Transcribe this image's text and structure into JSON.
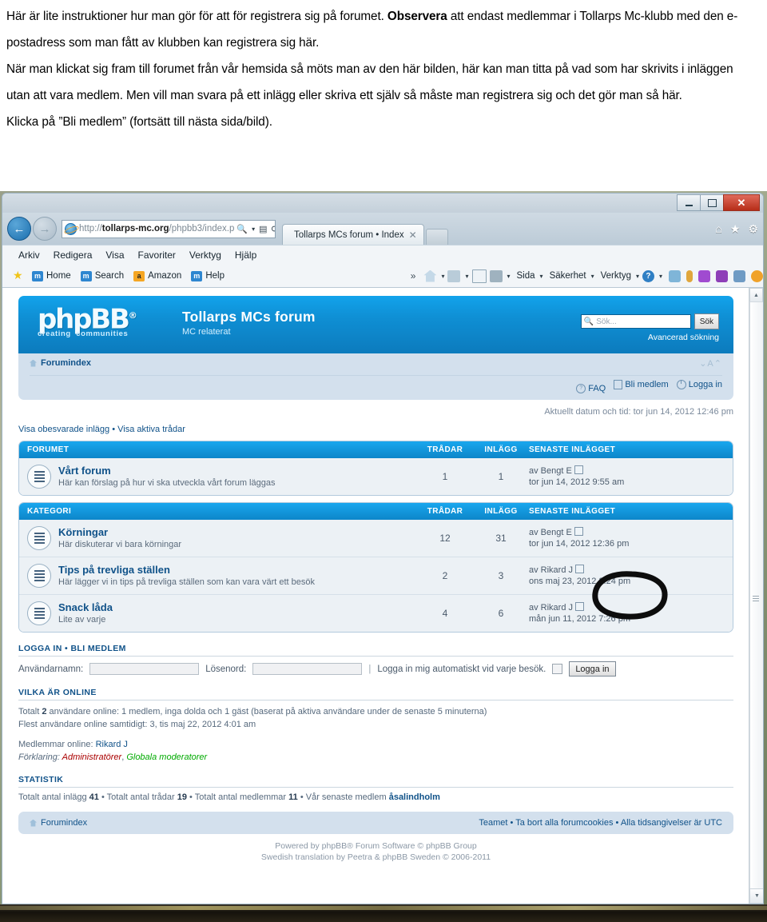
{
  "document": {
    "paragraphs": [
      {
        "parts": [
          {
            "t": "Här är lite instruktioner hur man gör för att för registrera sig på forumet. ",
            "b": false
          },
          {
            "t": "Observera",
            "b": true
          },
          {
            "t": " att endast medlemmar i Tollarps Mc-klubb med den e-postadress som man fått av klubben kan registrera sig här.",
            "b": false
          }
        ]
      },
      {
        "parts": [
          {
            "t": "När man klickat sig fram till forumet från vår hemsida så möts man av den här bilden, här kan man titta på vad som har skrivits i inläggen utan att vara medlem. Men vill man svara på ett inlägg eller skriva ett själv så måste man registrera sig och det gör man så här.",
            "b": false
          }
        ]
      },
      {
        "parts": [
          {
            "t": "Klicka på ”Bli medlem” (fortsätt till nästa sida/bild).",
            "b": false
          }
        ]
      }
    ]
  },
  "browser": {
    "url_prefix": "http://",
    "url_host": "tollarps-mc.org",
    "url_path": "/phpbb3/index.p",
    "tab_title": "Tollarps MCs forum • Index",
    "window_controls": {
      "minimize": "–",
      "restore": "□",
      "close": "✕"
    },
    "menu": [
      "Arkiv",
      "Redigera",
      "Visa",
      "Favoriter",
      "Verktyg",
      "Hjälp"
    ],
    "favorites": [
      {
        "label": "Home",
        "icon": "m-icon"
      },
      {
        "label": "Search",
        "icon": "m-icon"
      },
      {
        "label": "Amazon",
        "icon": "amazon-icon"
      },
      {
        "label": "Help",
        "icon": "m-icon"
      }
    ],
    "favorites_overflow": "»",
    "command_bar": [
      {
        "label": "Sida",
        "icon": "page-icon"
      },
      {
        "label": "Säkerhet",
        "icon": "security-icon"
      },
      {
        "label": "Verktyg",
        "icon": "tools-icon"
      }
    ],
    "address_icons": [
      "search-icon",
      "dropdown-caret",
      "compat-view-icon",
      "refresh-icon",
      "stop-icon"
    ],
    "nav_icons": [
      "home-icon",
      "favorites-star-icon",
      "settings-gear-icon"
    ]
  },
  "forum": {
    "logo": {
      "word": "phpBB",
      "reg": "®",
      "tagline_left": "creating",
      "tagline_right": "communities"
    },
    "title": "Tollarps MCs forum",
    "subtitle": "MC relaterat",
    "search": {
      "placeholder": "Sök...",
      "button": "Sök",
      "advanced": "Avancerad sökning"
    },
    "breadcrumb": "Forumindex",
    "font_resize": "⌄A⌃",
    "nav_links": [
      {
        "label": "FAQ",
        "icon": "question-icon"
      },
      {
        "label": "Bli medlem",
        "icon": "register-icon"
      },
      {
        "label": "Logga in",
        "icon": "power-icon"
      }
    ],
    "current_time": "Aktuellt datum och tid: tor jun 14, 2012 12:46 pm",
    "quick_links": [
      "Visa obesvarade inlägg",
      "Visa aktiva trådar"
    ],
    "quick_sep": " • ",
    "tables": [
      {
        "header": {
          "name": "FORUMET",
          "topics": "TRÅDAR",
          "posts": "INLÄGG",
          "last": "SENASTE INLÄGGET"
        },
        "rows": [
          {
            "name": "Vårt forum",
            "desc": "Här kan förslag på hur vi ska utveckla vårt forum läggas",
            "topics": "1",
            "posts": "1",
            "last_by": "av Bengt E",
            "last_date": "tor jun 14, 2012 9:55 am"
          }
        ]
      },
      {
        "header": {
          "name": "KATEGORI",
          "topics": "TRÅDAR",
          "posts": "INLÄGG",
          "last": "SENASTE INLÄGGET"
        },
        "rows": [
          {
            "name": "Körningar",
            "desc": "Här diskuterar vi bara körningar",
            "topics": "12",
            "posts": "31",
            "last_by": "av Bengt E",
            "last_date": "tor jun 14, 2012 12:36 pm"
          },
          {
            "name": "Tips på trevliga ställen",
            "desc": "Här lägger vi in tips på trevliga ställen som kan vara värt ett besök",
            "topics": "2",
            "posts": "3",
            "last_by": "av Rikard J",
            "last_date": "ons maj 23, 2012 2:24 pm"
          },
          {
            "name": "Snack låda",
            "desc": "Lite av varje",
            "topics": "4",
            "posts": "6",
            "last_by": "av Rikard J",
            "last_date": "mån jun 11, 2012 7:26 pm"
          }
        ]
      }
    ],
    "login_section": {
      "heading_login": "LOGGA IN",
      "heading_sep": " • ",
      "heading_register": "BLI MEDLEM",
      "username_label": "Användarnamn:",
      "username_value": "",
      "password_label": "Lösenord:",
      "password_value": "",
      "divider": "|",
      "autologin_label": "Logga in mig automatiskt vid varje besök.",
      "button": "Logga in"
    },
    "online_section": {
      "heading": "VILKA ÄR ONLINE",
      "line1_pre": "Totalt ",
      "line1_count": "2",
      "line1_post": " användare online: 1 medlem, inga dolda och 1 gäst (baserat på aktiva användare under de senaste 5 minuterna)",
      "line2": "Flest användare online samtidigt: 3, tis maj 22, 2012 4:01 am",
      "members_label": "Medlemmar online: ",
      "members_value": "Rikard J",
      "legend_label": "Förklaring: ",
      "legend_admin": "Administratörer",
      "legend_sep": ", ",
      "legend_mod": "Globala moderatorer"
    },
    "stats_section": {
      "heading": "STATISTIK",
      "posts_label": "Totalt antal inlägg ",
      "posts_value": "41",
      "topics_label": " • Totalt antal trådar ",
      "topics_value": "19",
      "members_label": " • Totalt antal medlemmar ",
      "members_value": "11",
      "newest_label": " • Vår senaste medlem ",
      "newest_value": "åsalindholm"
    },
    "footer": {
      "breadcrumb": "Forumindex",
      "links": [
        "Teamet",
        "Ta bort alla forumcookies",
        "Alla tidsangivelser är UTC"
      ],
      "sep": " • ",
      "copy_line1": "Powered by phpBB® Forum Software © phpBB Group",
      "copy_line2": "Swedish translation by Peetra & phpBB Sweden © 2006-2011"
    }
  },
  "annotation": {
    "target": "Bli medlem",
    "shape": "hand-drawn-ellipse",
    "color": "#0a0a0a"
  },
  "colors": {
    "brand_blue": "#12a3eb",
    "nav_blue": "#d3e0ed",
    "link_blue": "#105289",
    "admin_red": "#aa0000",
    "mod_green": "#00aa00",
    "close_red": "#b62d18"
  }
}
